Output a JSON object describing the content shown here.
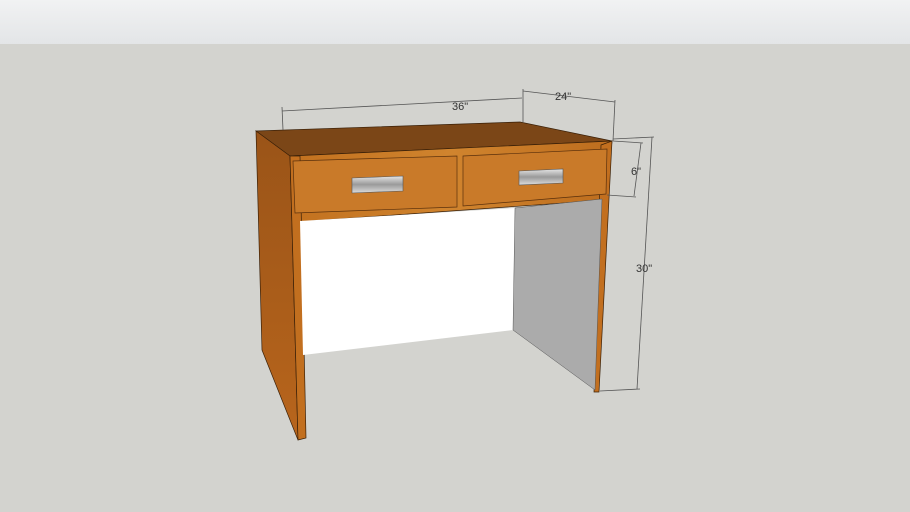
{
  "model": {
    "name": "desk"
  },
  "dimensions": {
    "width": "36\"",
    "depth": "24\"",
    "drawer_height": "6\"",
    "height": "30\""
  },
  "colors": {
    "wood": "#c0701f",
    "wood_dark": "#8a4a14",
    "top": "#7a4516",
    "inner": "#a9a9a9",
    "opening": "#ffffff",
    "background": "#d3d3cf"
  }
}
